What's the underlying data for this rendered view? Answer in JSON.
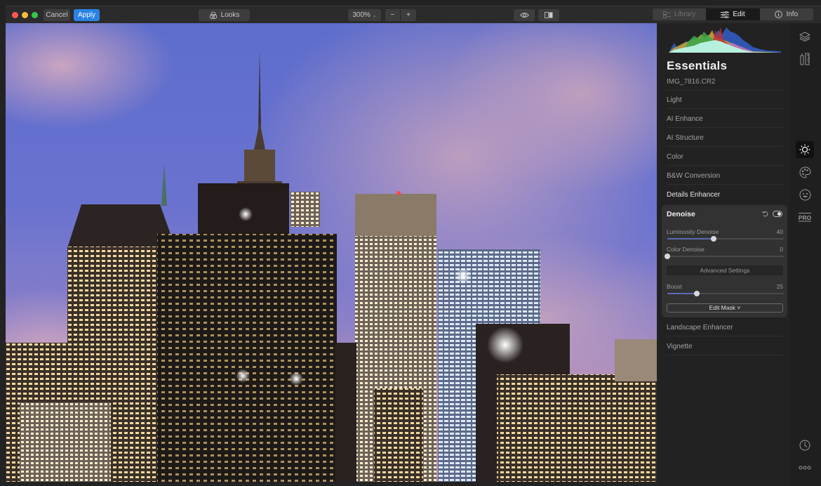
{
  "window": {
    "traffic_lights": [
      {
        "name": "close",
        "color": "#fc5753"
      },
      {
        "name": "minimize",
        "color": "#fdbc40"
      },
      {
        "name": "maximize",
        "color": "#33c748"
      }
    ]
  },
  "toolbar": {
    "cancel_label": "Cancel",
    "apply_label": "Apply",
    "looks_label": "Looks",
    "zoom_value": "300%",
    "zoom_out_label": "−",
    "zoom_in_label": "+",
    "tabs": [
      {
        "label": "Library",
        "icon": "library-icon",
        "state": "disabled"
      },
      {
        "label": "Edit",
        "icon": "sliders-icon",
        "state": "active"
      },
      {
        "label": "Info",
        "icon": "info-icon",
        "state": "normal"
      }
    ]
  },
  "panel": {
    "title": "Essentials",
    "filename": "IMG_7816.CR2",
    "sections_top": [
      "Light",
      "AI Enhance",
      "AI Structure",
      "Color",
      "B&W Conversion",
      "Details Enhancer"
    ],
    "active_section": "Details Enhancer",
    "denoise": {
      "title": "Denoise",
      "sliders": [
        {
          "label": "Luminosity Denoise",
          "value": "40",
          "fraction": 0.4
        },
        {
          "label": "Color Denoise",
          "value": "0",
          "fraction": 0.0
        }
      ],
      "advanced_label": "Advanced Settings",
      "boost": {
        "label": "Boost",
        "value": "25",
        "fraction": 0.25
      },
      "edit_mask_label": "Edit Mask ˅"
    },
    "sections_bottom": [
      "Landscape Enhancer",
      "Vignette"
    ]
  },
  "rail": {
    "icons": [
      "layers-icon",
      "presets-icon",
      "essentials-sun-icon",
      "creative-palette-icon",
      "portrait-face-icon",
      "pro-icon",
      "history-clock-icon",
      "more-icon"
    ],
    "active": "essentials-sun-icon",
    "pro_label": "PRO"
  },
  "colors": {
    "accent": "#2a82e4",
    "slider_fill": "#5e6ab4"
  }
}
